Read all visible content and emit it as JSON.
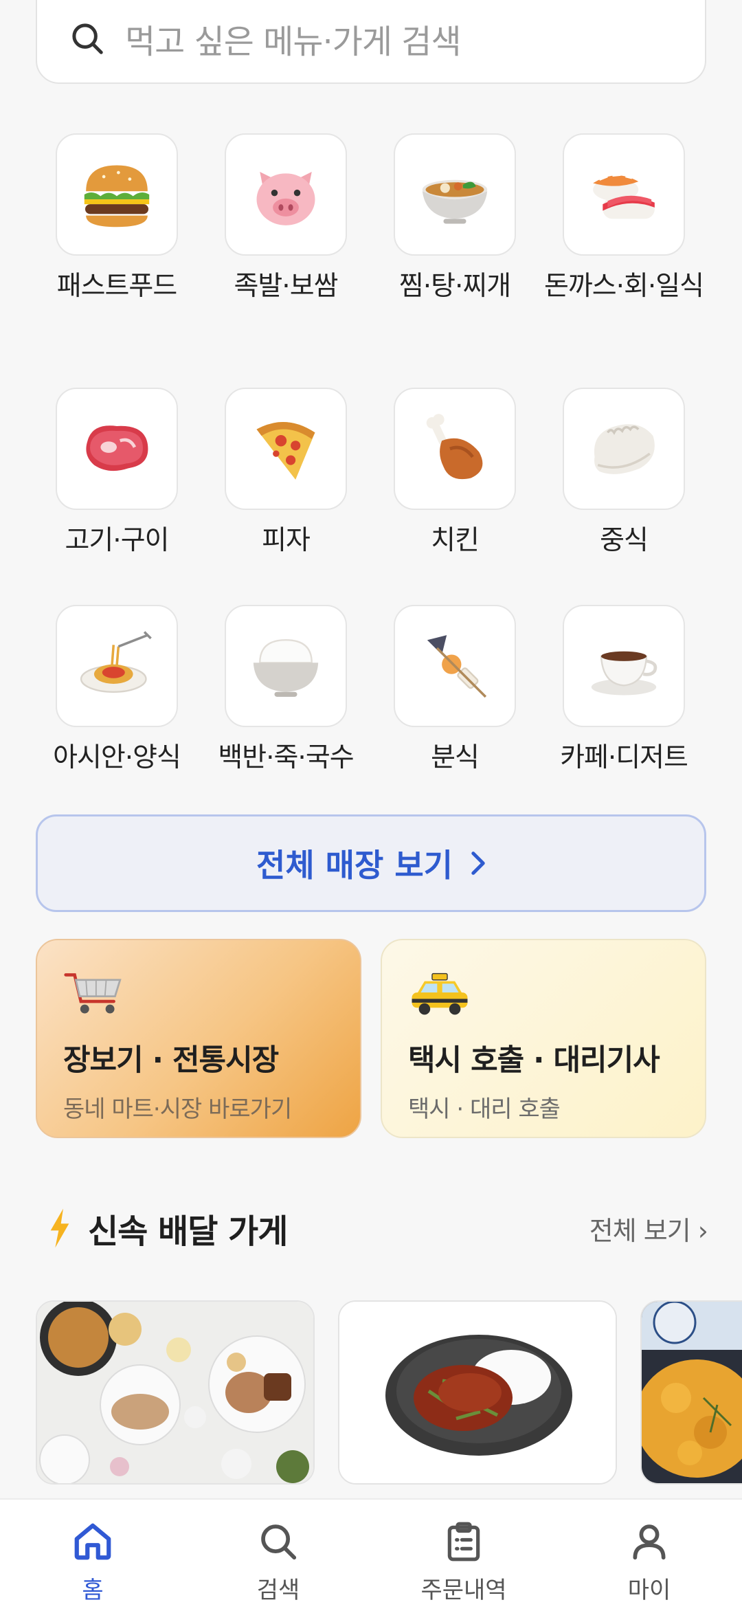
{
  "search": {
    "placeholder": "먹고 싶은 메뉴·가게 검색"
  },
  "categories": [
    {
      "label": "패스트푸드",
      "icon": "burger-icon"
    },
    {
      "label": "족발·보쌈",
      "icon": "pig-face-icon"
    },
    {
      "label": "찜·탕·찌개",
      "icon": "stew-bowl-icon"
    },
    {
      "label": "돈까스·회·일식",
      "icon": "sushi-icon"
    },
    {
      "label": "고기·구이",
      "icon": "meat-cut-icon"
    },
    {
      "label": "피자",
      "icon": "pizza-icon"
    },
    {
      "label": "치킨",
      "icon": "chicken-leg-icon"
    },
    {
      "label": "중식",
      "icon": "dumpling-icon"
    },
    {
      "label": "아시안·양식",
      "icon": "spaghetti-icon"
    },
    {
      "label": "백반·죽·국수",
      "icon": "rice-bowl-icon"
    },
    {
      "label": "분식",
      "icon": "oden-skewer-icon"
    },
    {
      "label": "카페·디저트",
      "icon": "coffee-cup-icon"
    }
  ],
  "all_stores": {
    "label": "전체 매장 보기"
  },
  "promos": {
    "market": {
      "title": "장보기 · 전통시장",
      "subtitle": "동네 마트·시장 바로가기",
      "icon": "shopping-cart-icon"
    },
    "taxi": {
      "title": "택시 호출 · 대리기사",
      "subtitle": "택시 · 대리 호출",
      "icon": "taxi-icon"
    }
  },
  "fast_delivery": {
    "title": "신속 배달 가게",
    "more": "전체 보기 ›",
    "icon": "lightning-icon"
  },
  "nav": {
    "home": "홈",
    "search": "검색",
    "orders": "주문내역",
    "my": "마이"
  },
  "colors": {
    "accent": "#3059d4",
    "background": "#f7f7f7"
  }
}
